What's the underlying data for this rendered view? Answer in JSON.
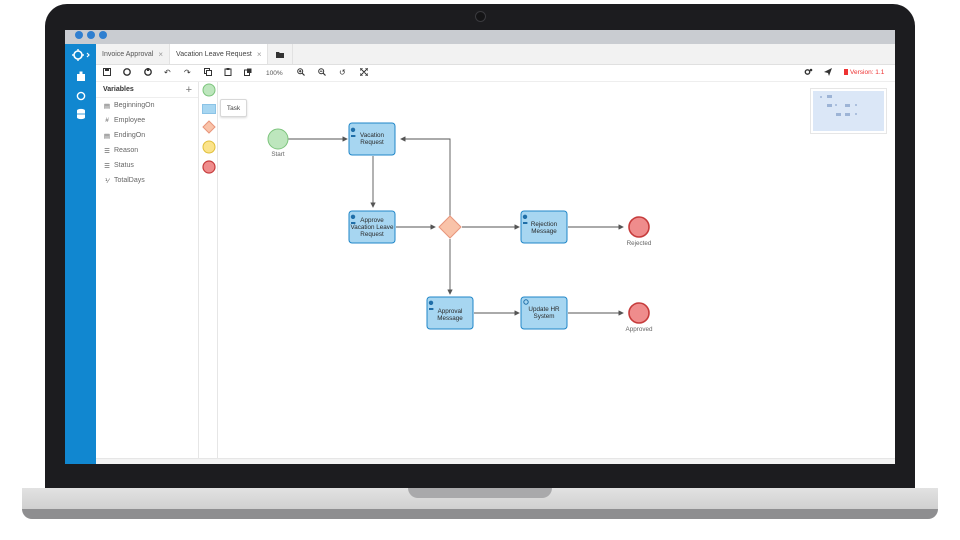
{
  "tabs": [
    {
      "label": "Invoice Approval"
    },
    {
      "label": "Vacation Leave Request"
    }
  ],
  "toolbar": {
    "zoom_label": "100%",
    "version_label": "Version: 1.1"
  },
  "variables": {
    "title": "Variables",
    "add_label": "+",
    "items": [
      {
        "icon": "calendar-icon",
        "label": "BeginningOn"
      },
      {
        "icon": "hash-icon",
        "label": "Employee"
      },
      {
        "icon": "calendar-icon",
        "label": "EndingOn"
      },
      {
        "icon": "list-icon",
        "label": "Reason"
      },
      {
        "icon": "list-icon",
        "label": "Status"
      },
      {
        "icon": "number-icon",
        "label": "TotalDays"
      }
    ]
  },
  "palette": {
    "tooltip": "Task",
    "items": [
      "start-event",
      "task",
      "gateway",
      "intermediate-event",
      "end-event"
    ]
  },
  "diagram": {
    "start_label": "Start",
    "tasks": {
      "vacation_request": [
        "Vacation",
        "Request"
      ],
      "approve": [
        "Approve",
        "Vacation Leave",
        "Request"
      ],
      "rejection": [
        "Rejection",
        "Message"
      ],
      "approval": [
        "Approval",
        "Message"
      ],
      "update_hr": [
        "Update HR",
        "System"
      ]
    },
    "rejected_label": "Rejected",
    "approved_label": "Approved"
  },
  "colors": {
    "accent": "#1187d0",
    "task_fill": "#a7d6f1",
    "task_stroke": "#1f86c8",
    "start_fill": "#bde6bd",
    "end_fill": "#ef8c8c",
    "gateway_fill": "#f9c3a9",
    "intermediate_fill": "#fbe38a",
    "version": "#ee3333"
  }
}
